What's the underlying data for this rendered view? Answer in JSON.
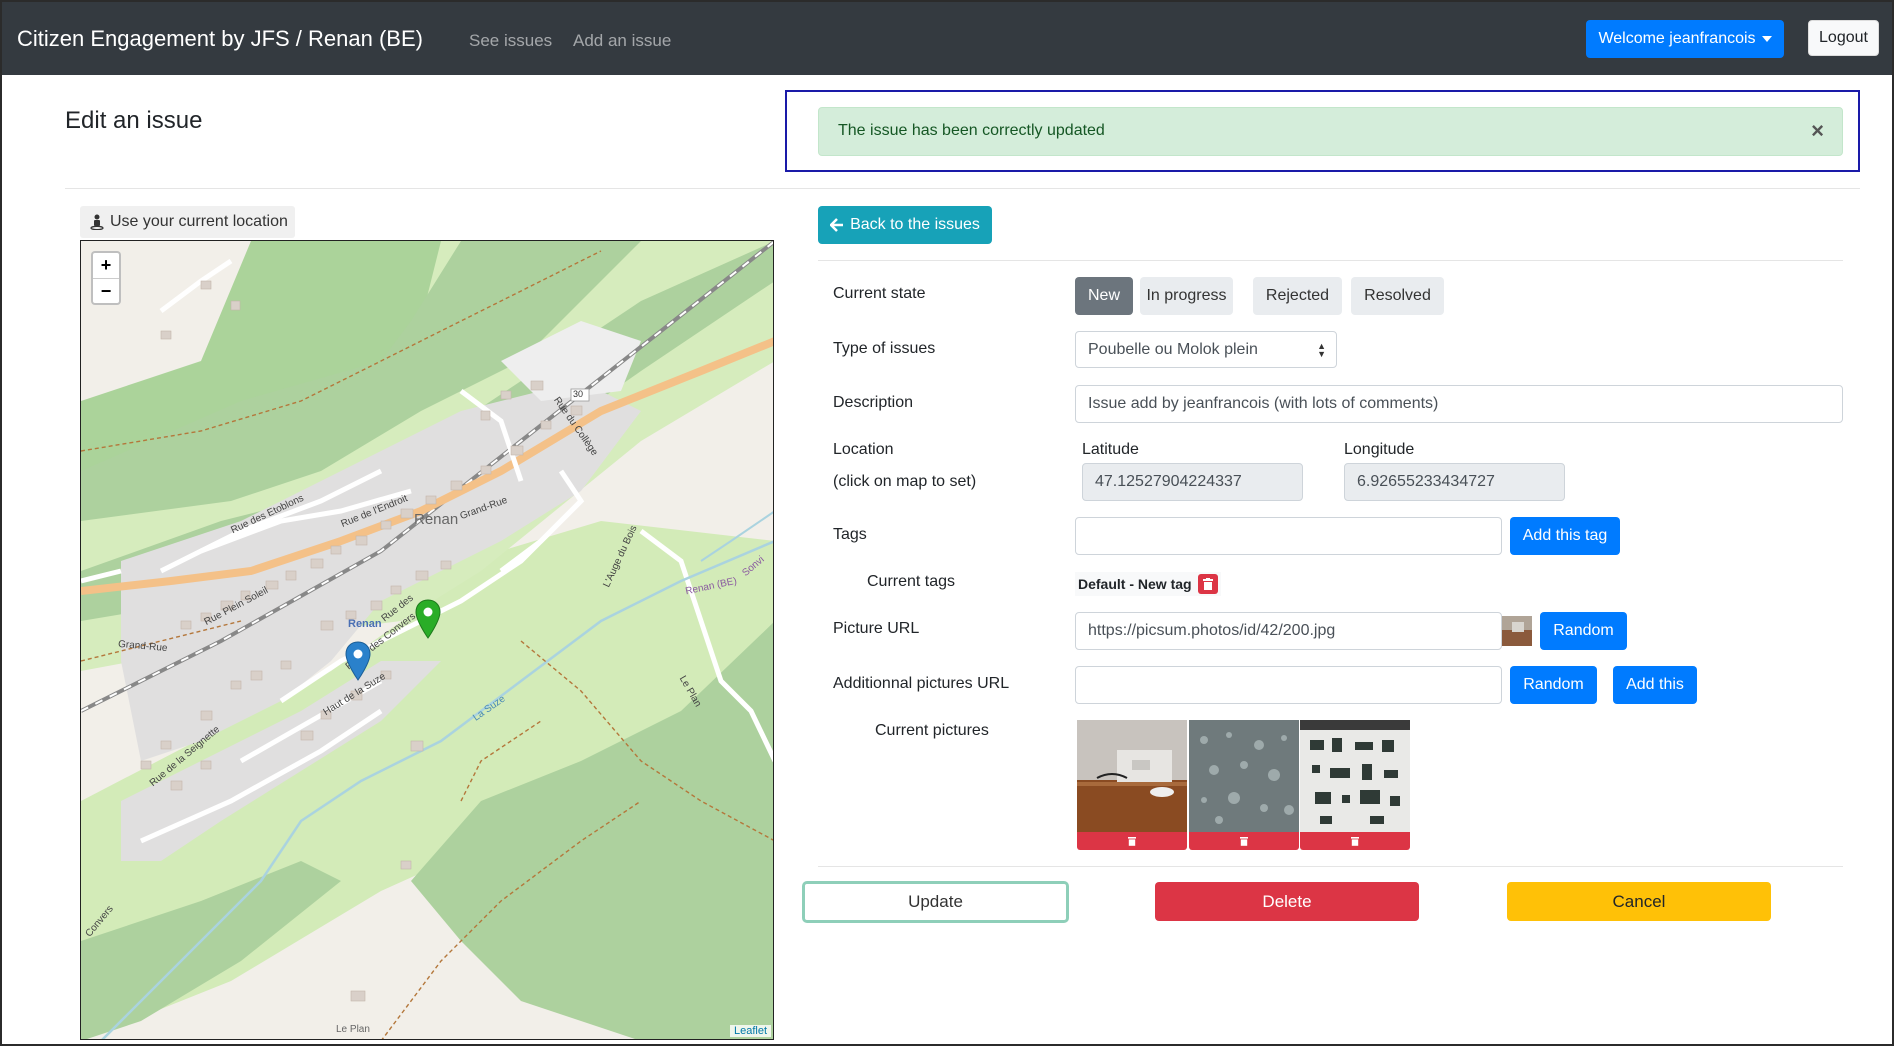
{
  "navbar": {
    "brand": "Citizen Engagement by JFS / Renan (BE)",
    "links": [
      "See issues",
      "Add an issue"
    ],
    "welcome": "Welcome jeanfrancois",
    "logout": "Logout"
  },
  "header": {
    "title": "Edit an issue",
    "alert": "The issue has been correctly updated",
    "alert_close": "×"
  },
  "map": {
    "location_button": "Use your current location",
    "zoom_in": "+",
    "zoom_out": "−",
    "attribution": "Leaflet",
    "labels": {
      "renan_center": "Renan",
      "renan_station": "Renan",
      "grand_rue_1": "Grand-Rue",
      "grand_rue_2": "Grand-Rue",
      "rue_etoblons": "Rue des Etoblons",
      "rue_endroit": "Rue de l'Endroit",
      "rue_plein_soleil": "Rue Plein Soleil",
      "route_convers": "Route des Convers",
      "rue_des": "Rue des",
      "haut_suze": "Haut de la Suze",
      "rue_seignette": "Rue de la Seignette",
      "rue_college": "Rue du Collège",
      "auge_du_bois": "L'Auge du Bois",
      "le_plan": "Le Plan",
      "renan_be": "Renan (BE)",
      "sonvi": "Sonvi",
      "la_suze": "La Suze",
      "convers": "Convers",
      "le_plan_bottom": "Le Plan",
      "road_30": "30"
    }
  },
  "form": {
    "back_button": "Back to the issues",
    "current_state_label": "Current state",
    "states": [
      "New",
      "In progress",
      "Rejected",
      "Resolved"
    ],
    "active_state": "New",
    "type_label": "Type of issues",
    "type_value": "Poubelle ou Molok plein",
    "description_label": "Description",
    "description_value": "Issue add by jeanfrancois (with lots of comments)",
    "location_label": "Location",
    "location_hint": "(click on map to set)",
    "latitude_label": "Latitude",
    "latitude_value": "47.12527904224337",
    "longitude_label": "Longitude",
    "longitude_value": "6.92655233434727",
    "tags_label": "Tags",
    "tags_value": "",
    "add_tag_button": "Add this tag",
    "current_tags_label": "Current tags",
    "current_tags": [
      "Default - New tag"
    ],
    "picture_url_label": "Picture URL",
    "picture_url_value": "https://picsum.photos/id/42/200.jpg",
    "random_button": "Random",
    "additional_label": "Additionnal pictures URL",
    "additional_value": "",
    "random_button_2": "Random",
    "add_this_button": "Add this",
    "current_pictures_label": "Current pictures"
  },
  "actions": {
    "update": "Update",
    "delete": "Delete",
    "cancel": "Cancel"
  },
  "colors": {
    "navbar": "#343a40",
    "primary": "#007bff",
    "info": "#17a2b8",
    "danger": "#dc3545",
    "warning": "#ffc107",
    "success_bg": "#d4edda",
    "secondary": "#6c757d"
  }
}
